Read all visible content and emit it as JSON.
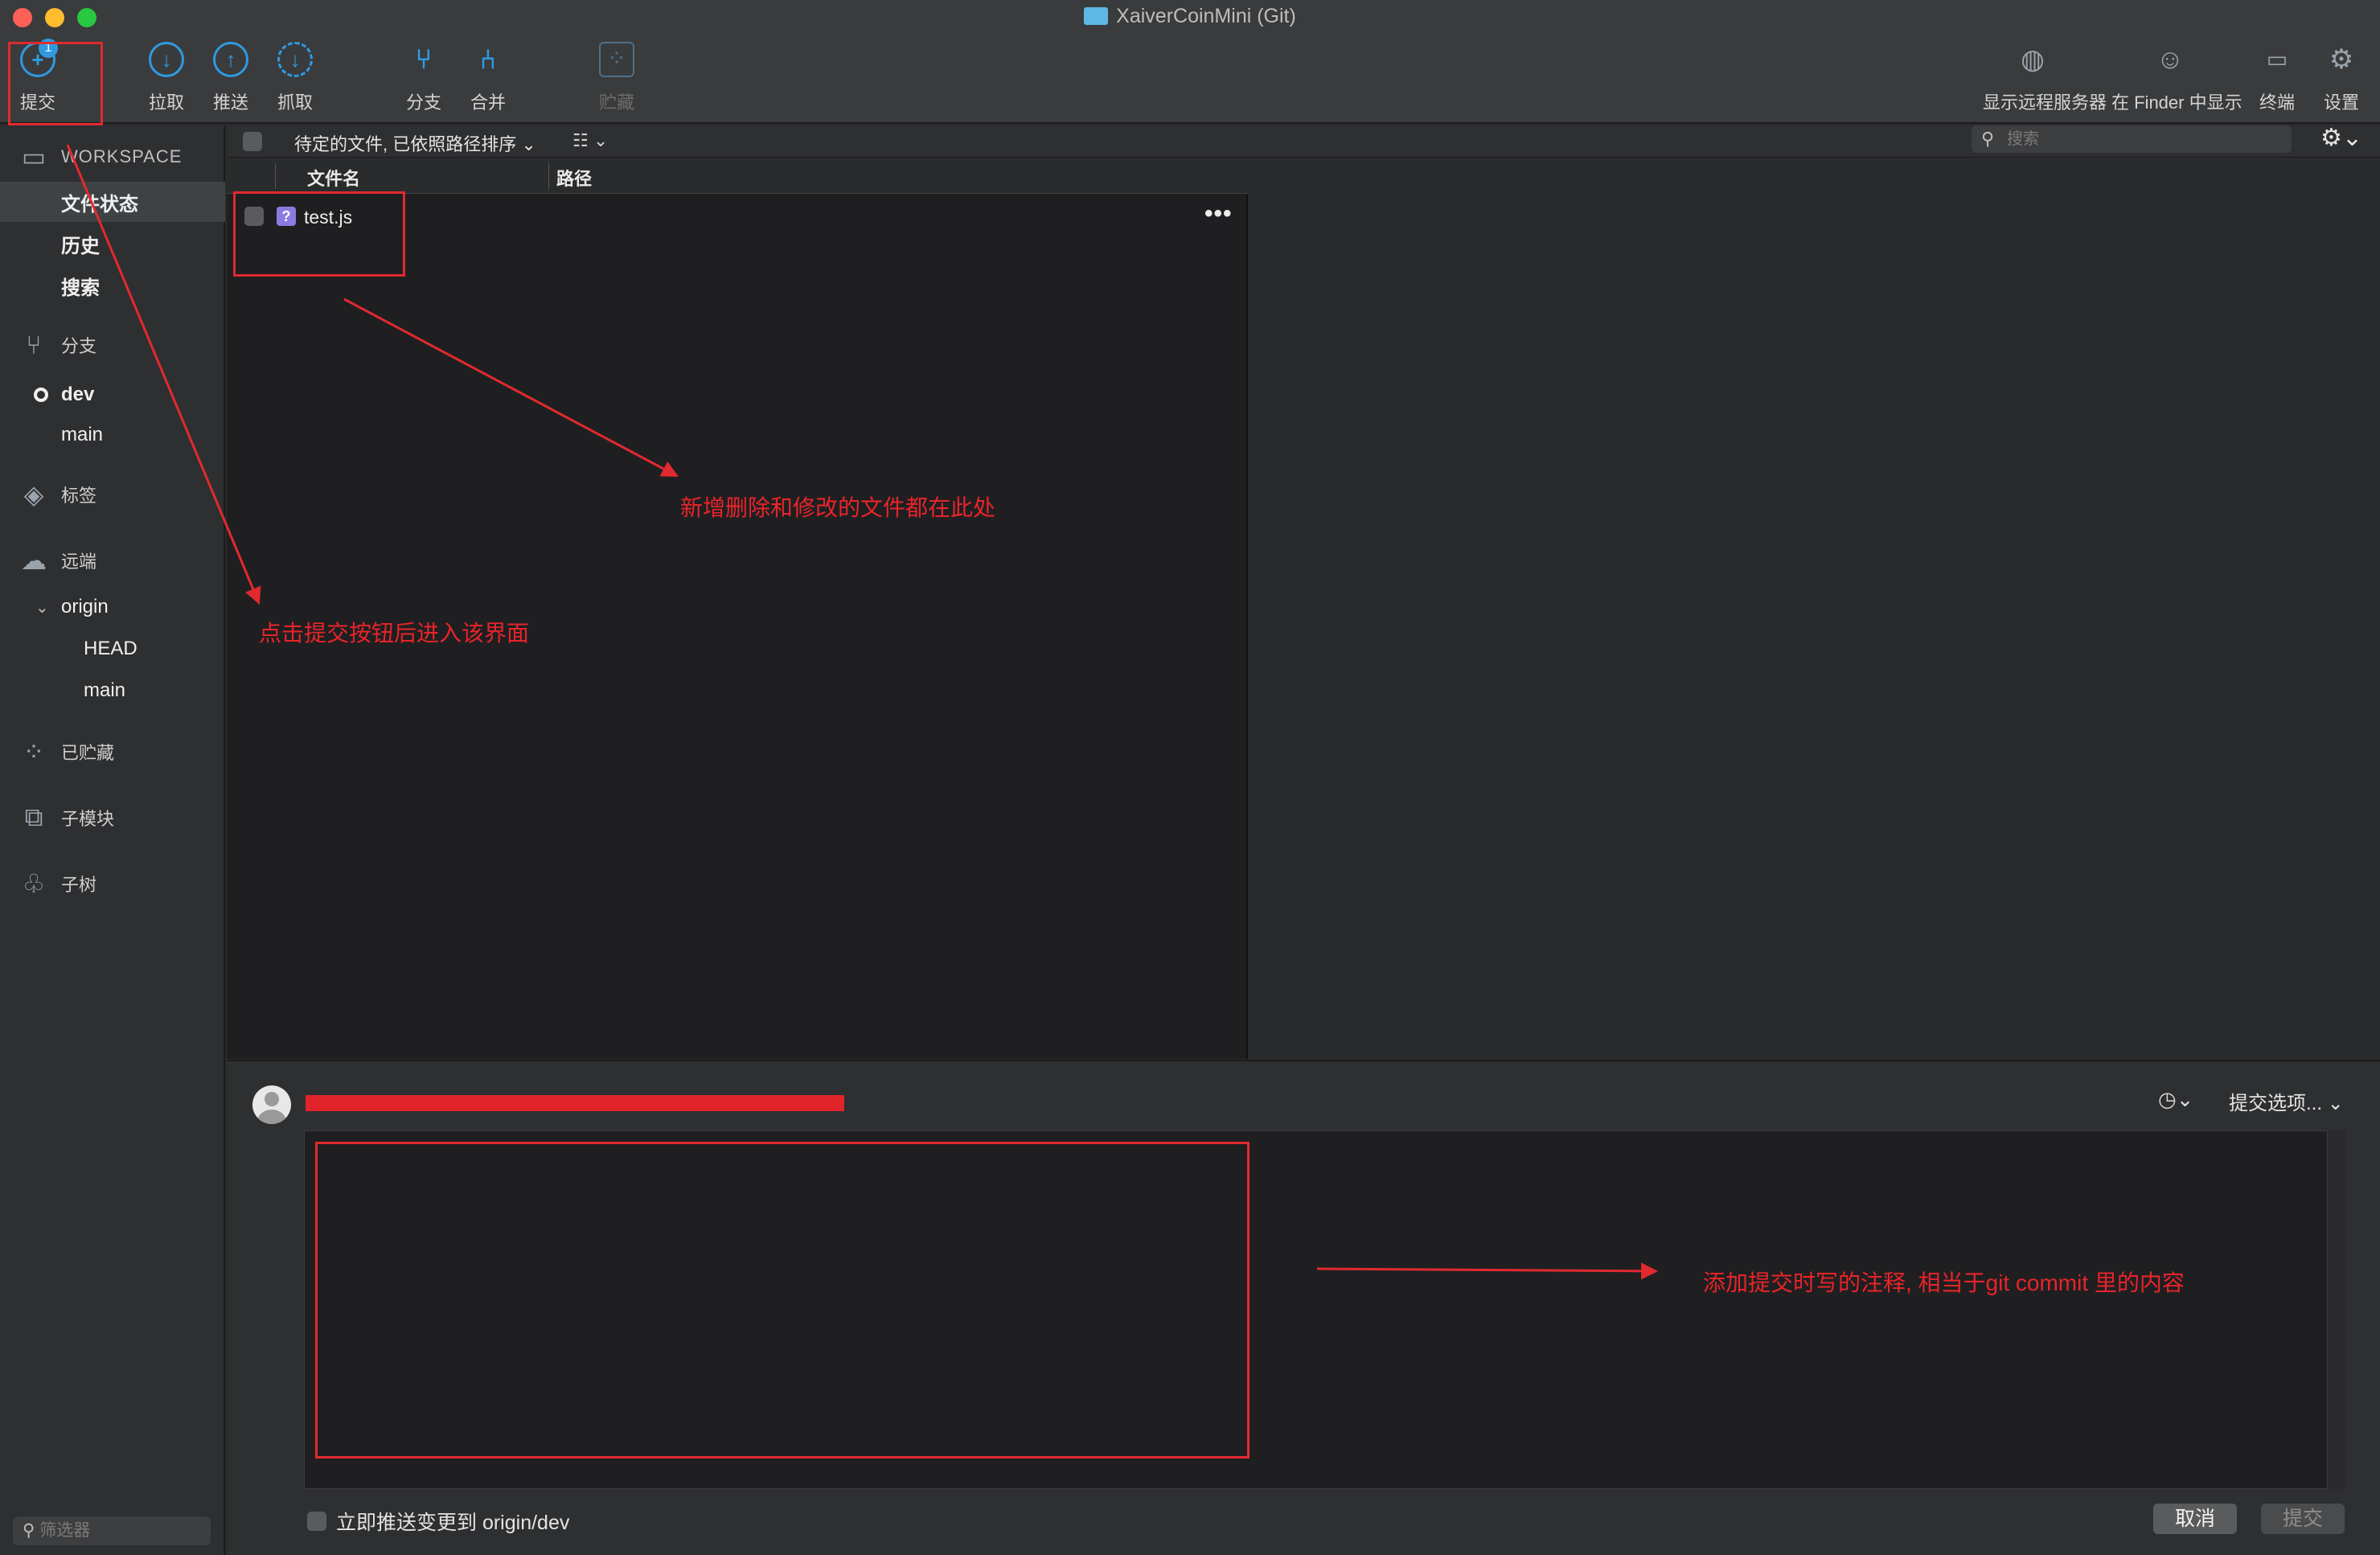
{
  "window": {
    "title": "XaiverCoinMini (Git)"
  },
  "toolbar": {
    "commit_label": "提交",
    "commit_badge": "1",
    "pull_label": "拉取",
    "push_label": "推送",
    "fetch_label": "抓取",
    "branch_label": "分支",
    "merge_label": "合并",
    "stash_label": "贮藏",
    "show_remote_label": "显示远程服务器",
    "show_in_finder_label": "在 Finder 中显示",
    "terminal_label": "终端",
    "settings_label": "设置"
  },
  "sidebar": {
    "workspace_label": "WORKSPACE",
    "workspace_items": [
      "文件状态",
      "历史",
      "搜索"
    ],
    "branches_label": "分支",
    "branches": [
      "dev",
      "main"
    ],
    "tags_label": "标签",
    "remotes_label": "远端",
    "remote_name": "origin",
    "remote_branches": [
      "HEAD",
      "main"
    ],
    "stashes_label": "已贮藏",
    "submodules_label": "子模块",
    "subtrees_label": "子树",
    "filter_placeholder": "筛选器"
  },
  "file_list": {
    "sort_label": "待定的文件, 已依照路径排序 ⌄",
    "view_toggle": "☷ ⌄",
    "search_placeholder": "搜索",
    "columns": [
      "文件名",
      "路径"
    ],
    "files": [
      {
        "status_icon": "?",
        "name": "test.js"
      }
    ],
    "more_button": "•••"
  },
  "commit": {
    "history_button": "◷⌄",
    "options_label": "提交选项... ⌄",
    "push_immediately_label": "立即推送变更到 origin/dev",
    "cancel_label": "取消",
    "commit_label": "提交"
  },
  "annotations": {
    "commit_button_note": "点击提交按钮后进入该界面",
    "files_note": "新增删除和修改的文件都在此处",
    "message_note": "添加提交时写的注释, 相当于git commit 里的内容"
  },
  "colors": {
    "accent": "#2f9ae0",
    "annotation": "#e02a2f"
  }
}
